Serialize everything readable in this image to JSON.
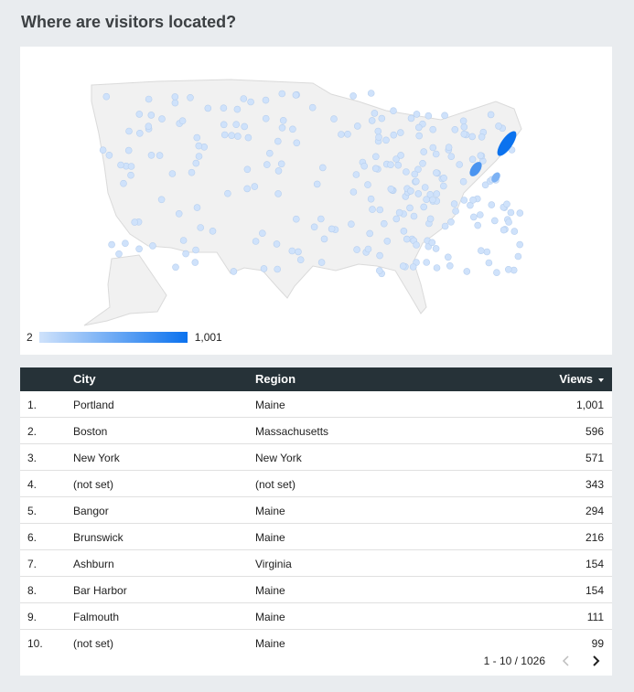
{
  "title": "Where are visitors located?",
  "map": {
    "legend_min": "2",
    "legend_max": "1,001",
    "color_low": "#cfe2fb",
    "color_high": "#0b72ee"
  },
  "table": {
    "header_bg": "#263238",
    "columns": {
      "city": "City",
      "region": "Region",
      "views": "Views"
    },
    "sort_icon": "sort-descending-icon",
    "rows": [
      {
        "idx": "1.",
        "city": "Portland",
        "region": "Maine",
        "views": "1,001"
      },
      {
        "idx": "2.",
        "city": "Boston",
        "region": "Massachusetts",
        "views": "596"
      },
      {
        "idx": "3.",
        "city": "New York",
        "region": "New York",
        "views": "571"
      },
      {
        "idx": "4.",
        "city": "(not set)",
        "region": "(not set)",
        "views": "343"
      },
      {
        "idx": "5.",
        "city": "Bangor",
        "region": "Maine",
        "views": "294"
      },
      {
        "idx": "6.",
        "city": "Brunswick",
        "region": "Maine",
        "views": "216"
      },
      {
        "idx": "7.",
        "city": "Ashburn",
        "region": "Virginia",
        "views": "154"
      },
      {
        "idx": "8.",
        "city": "Bar Harbor",
        "region": "Maine",
        "views": "154"
      },
      {
        "idx": "9.",
        "city": "Falmouth",
        "region": "Maine",
        "views": "111"
      },
      {
        "idx": "10.",
        "city": "(not set)",
        "region": "Maine",
        "views": "99"
      }
    ],
    "pagination": {
      "label": "1 - 10 / 1026",
      "prev_icon": "chevron-left-icon",
      "next_icon": "chevron-right-icon"
    }
  }
}
